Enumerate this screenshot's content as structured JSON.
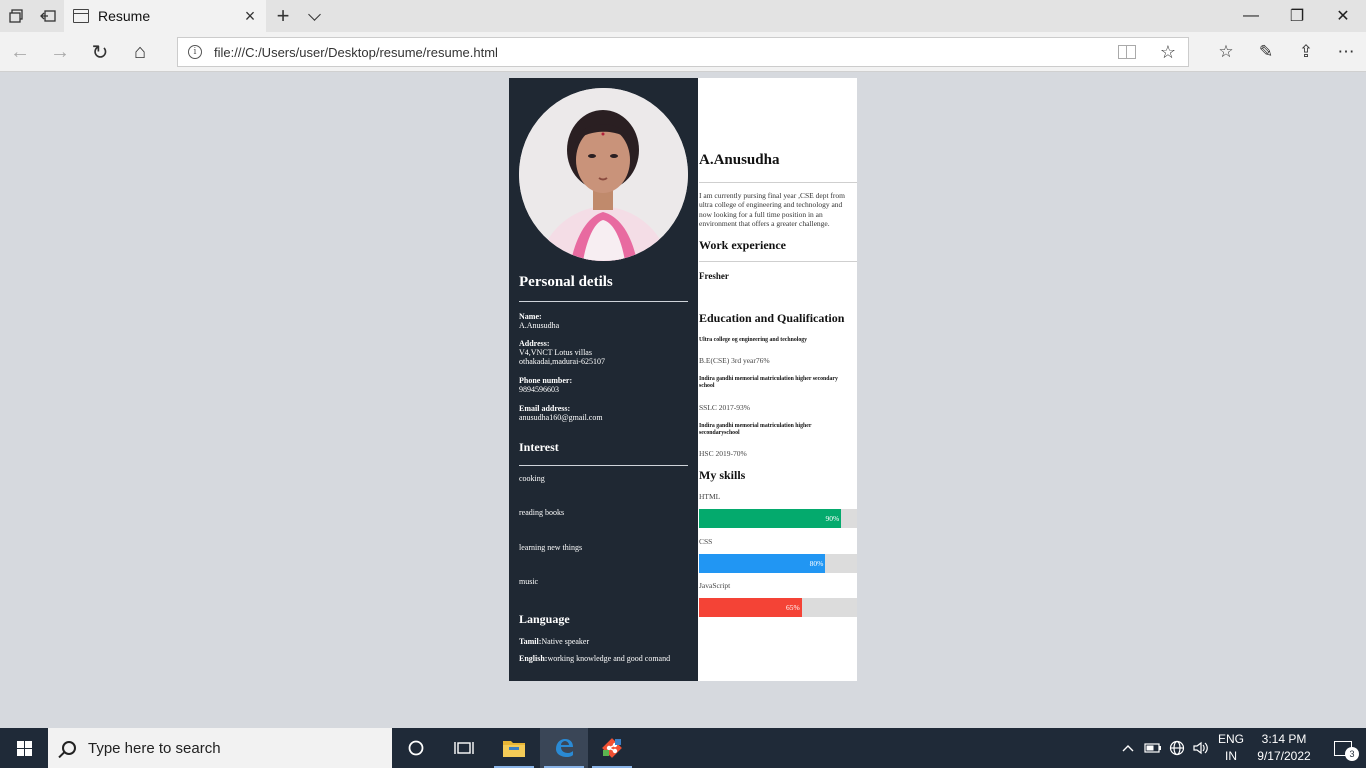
{
  "browser": {
    "tab": {
      "title": "Resume",
      "close_icon": "×"
    },
    "new_tab_icon": "+",
    "url": "file:///C:/Users/user/Desktop/resume/resume.html",
    "window_controls": {
      "minimize": "—",
      "restore": "❐",
      "close": "✕"
    },
    "nav_icons": {
      "back": "←",
      "forward": "→",
      "refresh": "↻",
      "home": "⌂",
      "info": "i",
      "favorite": "☆",
      "favorites_bar": "☆",
      "notes": "✎",
      "share": "⇪",
      "more": "⋯"
    }
  },
  "resume": {
    "personal": {
      "heading": "Personal detils",
      "name_label": "Name:",
      "name_value": "A.Anusudha",
      "address_label": "Address:",
      "address_line1": "V4,VNCT Lotus villas",
      "address_line2": "othakadai,madurai-625107",
      "phone_label": "Phone number:",
      "phone_value": "9894596603",
      "email_label": "Email address:",
      "email_value": "anusudha160@gmail.com"
    },
    "interest": {
      "heading": "Interest",
      "items": [
        "cooking",
        "reading books",
        "learning new things",
        "music"
      ]
    },
    "language": {
      "heading": "Language",
      "tamil_label": "Tamil:",
      "tamil_value": "Native speaker",
      "english_label": "English:",
      "english_value": "working knowledge and good comand"
    },
    "name": "A.Anusudha",
    "summary": "I am currently pursing final year ,CSE dept from ultra college of engineering and technology and now looking for a full time position in an environment that offers a greater challenge.",
    "work": {
      "heading": "Work experience",
      "value": "Fresher"
    },
    "education": {
      "heading": "Education and Qualification",
      "items": [
        {
          "school": "Ultra college og engineering and technology",
          "grade": "B.E(CSE) 3rd year76%"
        },
        {
          "school": "Indira gandhi memorial matriculation higher secondary school",
          "grade": "SSLC 2017-93%"
        },
        {
          "school": "Indira gandhi memorial matriculation higher secondaryschool",
          "grade": "HSC 2019-70%"
        }
      ]
    },
    "skills": {
      "heading": "My skills",
      "items": [
        {
          "name": "HTML",
          "label": "90%",
          "percent": 90,
          "color": "#04aa6d"
        },
        {
          "name": "CSS",
          "label": "80%",
          "percent": 80,
          "color": "#2196f3"
        },
        {
          "name": "JavaScript",
          "label": "65%",
          "percent": 65,
          "color": "#f44336"
        }
      ]
    }
  },
  "taskbar": {
    "search_placeholder": "Type here to search",
    "lang_line1": "ENG",
    "lang_line2": "IN",
    "time": "3:14 PM",
    "date": "9/17/2022",
    "notification_count": "3"
  }
}
